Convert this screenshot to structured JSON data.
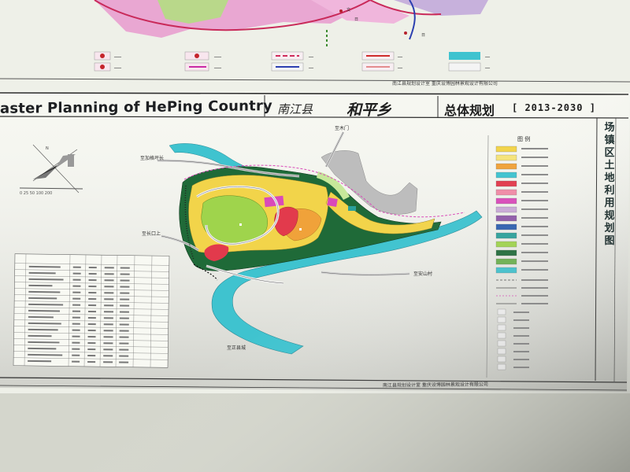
{
  "title": {
    "english": "aster Planning of HePing Country",
    "county": "南江县",
    "town": "和平乡",
    "plan": "总体规划",
    "years": "[ 2013-2030 ]"
  },
  "vertical_title": "场镇区土地利用规划图",
  "legend_heading": "图 例",
  "road_labels": {
    "north": "至木门",
    "northwest": "至加格坪长",
    "west": "至长口上",
    "east": "至安山村",
    "south": "至正县城"
  },
  "footer_credit": "南江县规划设计室 重庆设博园林景观设计有限公司",
  "top_credit": "南江县规划设计室 重庆设博园林景观设计有限公司",
  "colors": {
    "screen_bg": "#f4f5ee",
    "river": "#3fc3cf",
    "residential": "#f2d44a",
    "green": "#9fd44c",
    "forest": "#1f6a38",
    "public": "#e23a4c",
    "pink": "#d94ab9",
    "industrial": "#bdbdbd"
  }
}
